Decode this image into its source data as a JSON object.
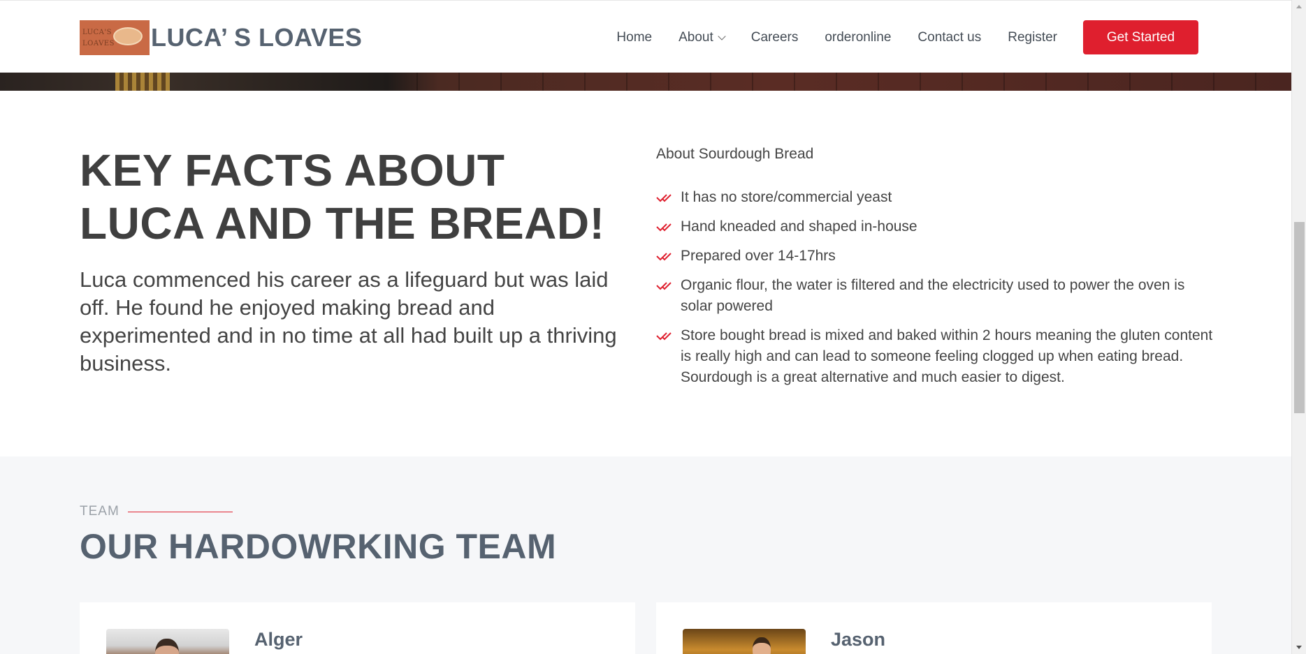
{
  "header": {
    "logo_text": "LUCA’ S LOAVES",
    "logo_image_text_line1": "LUCA'S",
    "logo_image_text_line2": "LOAVES",
    "nav": [
      {
        "label": "Home"
      },
      {
        "label": "About"
      },
      {
        "label": "Careers"
      },
      {
        "label": "orderonline"
      },
      {
        "label": "Contact us"
      },
      {
        "label": "Register"
      }
    ],
    "cta_label": "Get Started"
  },
  "facts": {
    "title": "KEY FACTS ABOUT LUCA AND THE BREAD!",
    "paragraph": "Luca commenced his career as a lifeguard but was laid off. He found he enjoyed making bread and experimented and in no time at all had built up a thriving business.",
    "about_label": "About Sourdough Bread",
    "items": [
      "It has no store/commercial yeast",
      "Hand kneaded and shaped in-house",
      "Prepared over 14-17hrs",
      "Organic flour, the water is filtered and the electricity used to power the oven is solar powered",
      "Store bought bread is mixed and baked within 2 hours meaning the gluten content is really high and can lead to someone feeling clogged up when eating bread. Sourdough is a great alternative and much easier to digest."
    ]
  },
  "team": {
    "kicker": "TEAM",
    "title": "OUR HARDOWRKING TEAM",
    "members": [
      {
        "name": "Alger"
      },
      {
        "name": "Jason"
      }
    ]
  },
  "colors": {
    "accent": "#df1f2e",
    "heading": "#566270",
    "text": "#444444"
  },
  "icons": {
    "check": "double-check-icon",
    "dropdown": "chevron-down-icon"
  }
}
